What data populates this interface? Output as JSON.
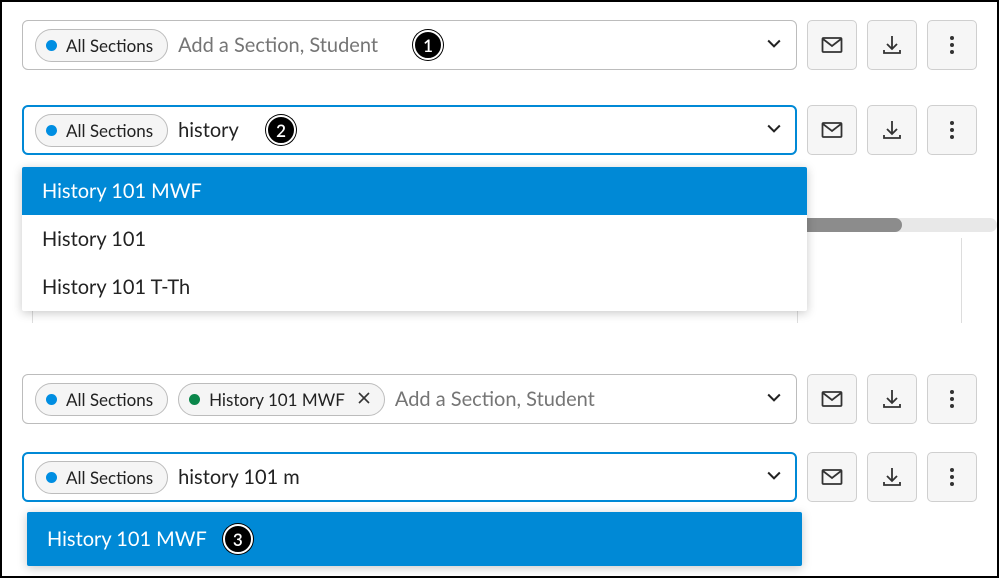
{
  "chips": {
    "all_sections": "All Sections",
    "history_mwf": "History 101 MWF"
  },
  "placeholders": {
    "add_section": "Add a Section, Student"
  },
  "inputs": {
    "row2": "history",
    "row4": "history 101 m"
  },
  "dropdowns": {
    "row2": [
      "History 101 MWF",
      "History 101",
      "History 101 T-Th"
    ],
    "row4": [
      "History 101 MWF"
    ]
  },
  "markers": {
    "one": "1",
    "two": "2",
    "three": "3"
  }
}
